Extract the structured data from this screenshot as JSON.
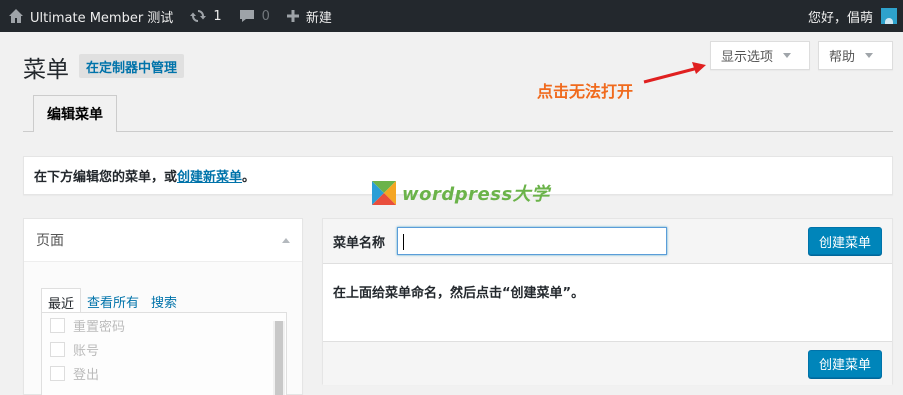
{
  "adminbar": {
    "site_name": "Ultimate Member 测试",
    "updates_count": "1",
    "comments_count": "0",
    "new_label": "新建",
    "greeting": "您好，倡萌"
  },
  "header": {
    "title": "菜单",
    "manage_label": "在定制器中管理",
    "screen_options_label": "显示选项",
    "help_label": "帮助"
  },
  "annotation": {
    "text": "点击无法打开",
    "color": "#f06a1d"
  },
  "tabs": [
    {
      "label": "编辑菜单"
    }
  ],
  "notice": {
    "prefix": "在下方编辑您的菜单，或",
    "link": "创建新菜单",
    "suffix": "。"
  },
  "watermark": {
    "text": "wordpress大学"
  },
  "left_panel": {
    "title": "页面",
    "tabs": [
      "最近",
      "查看所有",
      "搜索"
    ],
    "items": [
      "重置密码",
      "账号",
      "登出"
    ]
  },
  "right_panel": {
    "name_label": "菜单名称",
    "name_value": "",
    "create_label": "创建菜单",
    "hint": "在上面给菜单命名，然后点击“创建菜单”。"
  },
  "colors": {
    "adminbar_bg": "#23282d",
    "primary": "#0085ba",
    "link": "#0073aa",
    "watermark": "#6bb34a"
  }
}
